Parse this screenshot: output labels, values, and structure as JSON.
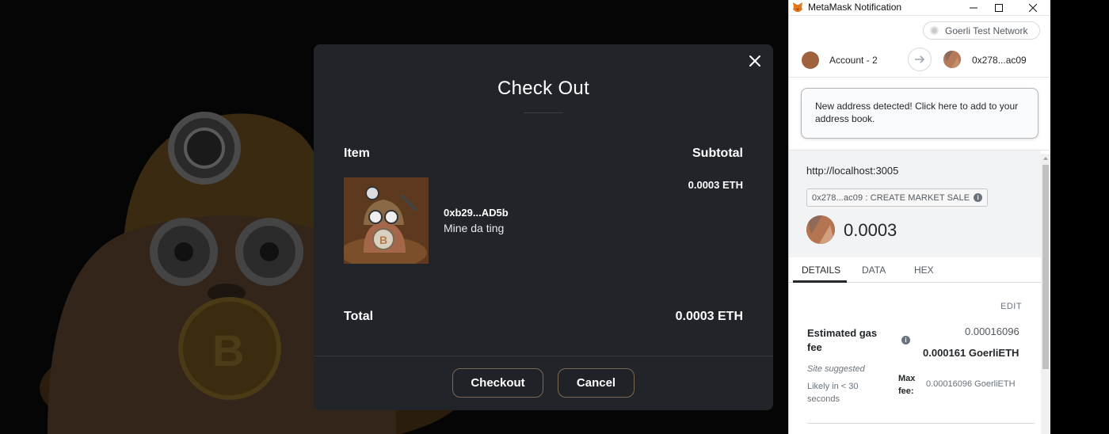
{
  "modal": {
    "title": "Check Out",
    "columns": {
      "item": "Item",
      "subtotal": "Subtotal"
    },
    "item": {
      "name": "0xb29...AD5b",
      "description": "Mine da ting",
      "price": "0.0003 ETH"
    },
    "total": {
      "label": "Total",
      "value": "0.0003 ETH"
    },
    "buttons": {
      "checkout": "Checkout",
      "cancel": "Cancel"
    }
  },
  "metamask": {
    "window_title": "MetaMask Notification",
    "network": "Goerli Test Network",
    "from_account": "Account - 2",
    "to_address": "0x278...ac09",
    "notice": "New address detected! Click here to add to your address book.",
    "origin": "http://localhost:3005",
    "method": "0x278...ac09 : CREATE MARKET SALE",
    "amount": "0.0003",
    "tabs": [
      "DETAILS",
      "DATA",
      "HEX"
    ],
    "edit": "EDIT",
    "gas": {
      "label": "Estimated gas fee",
      "primary": "0.00016096",
      "secondary": "0.000161 GoerliETH",
      "site_suggested": "Site suggested",
      "likely": "Likely in < 30 seconds",
      "max_fee_label": "Max fee:",
      "max_fee_value": "0.00016096 GoerliETH"
    }
  },
  "colors": {
    "modal_bg": "#212429",
    "page_bg": "#050505",
    "button_border": "#7a6a55",
    "accent_brown": "#a0623e"
  }
}
